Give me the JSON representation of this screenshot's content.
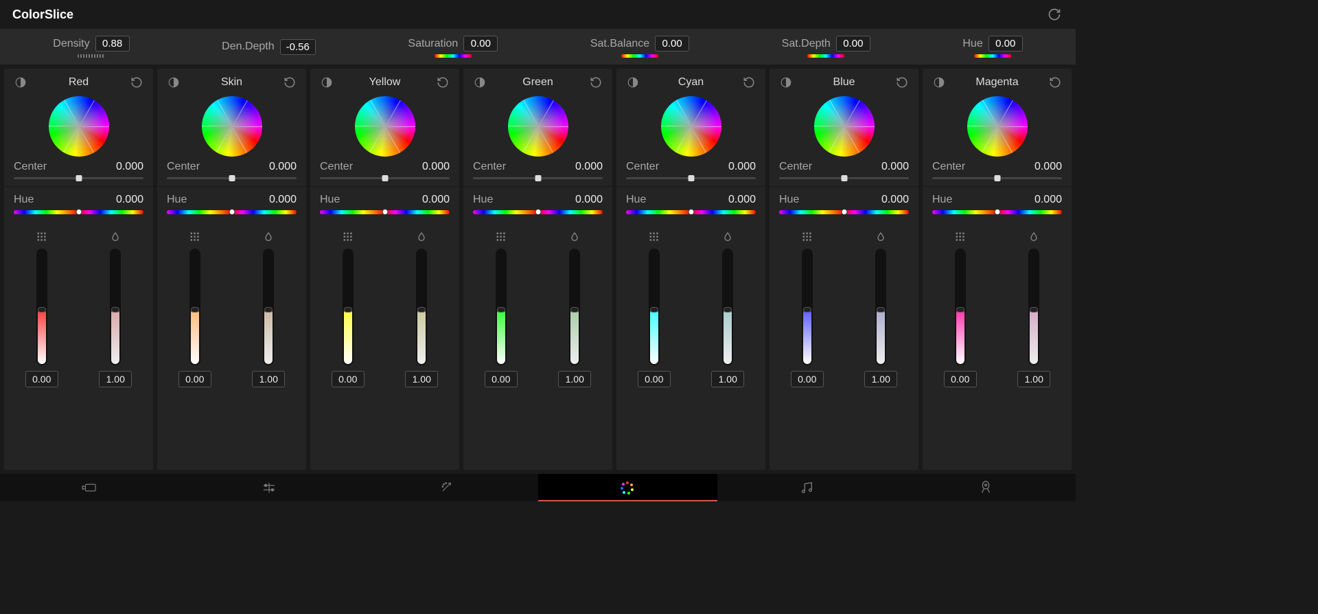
{
  "title": "ColorSlice",
  "globals": [
    {
      "label": "Density",
      "value": "0.88",
      "indicator": "dots"
    },
    {
      "label": "Den.Depth",
      "value": "-0.56",
      "indicator": "none"
    },
    {
      "label": "Saturation",
      "value": "0.00",
      "indicator": "spectrum"
    },
    {
      "label": "Sat.Balance",
      "value": "0.00",
      "indicator": "spectrum"
    },
    {
      "label": "Sat.Depth",
      "value": "0.00",
      "indicator": "spectrum"
    },
    {
      "label": "Hue",
      "value": "0.00",
      "indicator": "spectrum"
    }
  ],
  "center_label": "Center",
  "hue_label": "Hue",
  "channels": [
    {
      "name": "Red",
      "center": "0.000",
      "hue": "0.000",
      "sat": "0.00",
      "den": "1.00",
      "c1": "#ff3b3b",
      "c2": "#d9a7a7"
    },
    {
      "name": "Skin",
      "center": "0.000",
      "hue": "0.000",
      "sat": "0.00",
      "den": "1.00",
      "c1": "#ffb97a",
      "c2": "#cbb9a4"
    },
    {
      "name": "Yellow",
      "center": "0.000",
      "hue": "0.000",
      "sat": "0.00",
      "den": "1.00",
      "c1": "#ffff40",
      "c2": "#c9c99f"
    },
    {
      "name": "Green",
      "center": "0.000",
      "hue": "0.000",
      "sat": "0.00",
      "den": "1.00",
      "c1": "#36ff36",
      "c2": "#a8cca8"
    },
    {
      "name": "Cyan",
      "center": "0.000",
      "hue": "0.000",
      "sat": "0.00",
      "den": "1.00",
      "c1": "#40ffff",
      "c2": "#a8cccc"
    },
    {
      "name": "Blue",
      "center": "0.000",
      "hue": "0.000",
      "sat": "0.00",
      "den": "1.00",
      "c1": "#5a5aff",
      "c2": "#acaccf"
    },
    {
      "name": "Magenta",
      "center": "0.000",
      "hue": "0.000",
      "sat": "0.00",
      "den": "1.00",
      "c1": "#ff33aa",
      "c2": "#d4aac6"
    }
  ],
  "nav_tabs": [
    "cut",
    "edit",
    "fusion",
    "color",
    "fairlight",
    "deliver"
  ],
  "active_tab_index": 3
}
